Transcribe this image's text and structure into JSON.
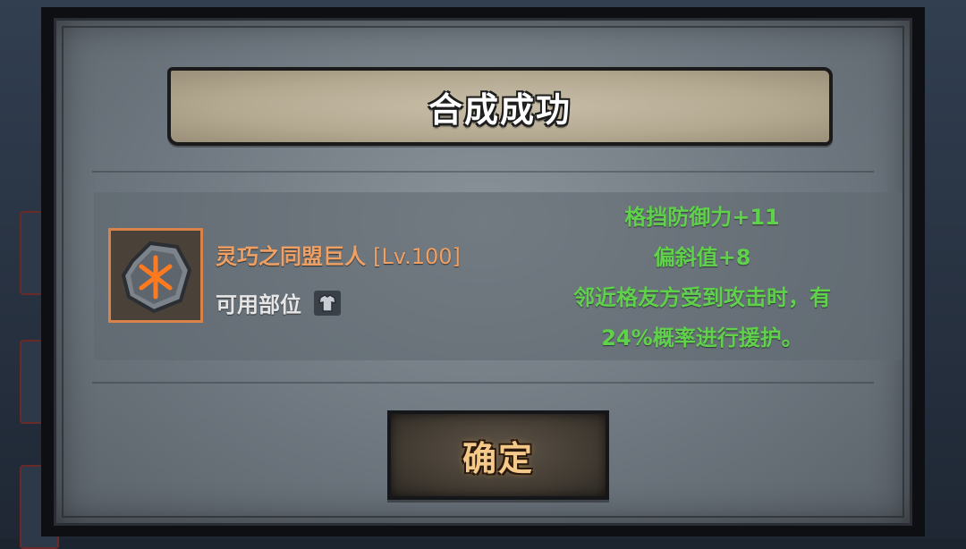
{
  "dialog": {
    "title": "合成成功"
  },
  "item": {
    "name": "灵巧之同盟巨人",
    "level": "[Lv.100]",
    "slot_label": "可用部位",
    "slot_icon": "armor-icon",
    "rune_icon": "rune-stone-icon"
  },
  "stats": {
    "line1": "格挡防御力+11",
    "line2": "偏斜值+8",
    "line3": "邻近格友方受到攻击时，有",
    "line4": "24%概率进行援护。"
  },
  "buttons": {
    "confirm": "确定"
  },
  "colors": {
    "item_name": "#f0a062",
    "stat_text": "#5fd14a",
    "confirm_text": "#f4c98a",
    "frame_accent": "#d9824a"
  }
}
